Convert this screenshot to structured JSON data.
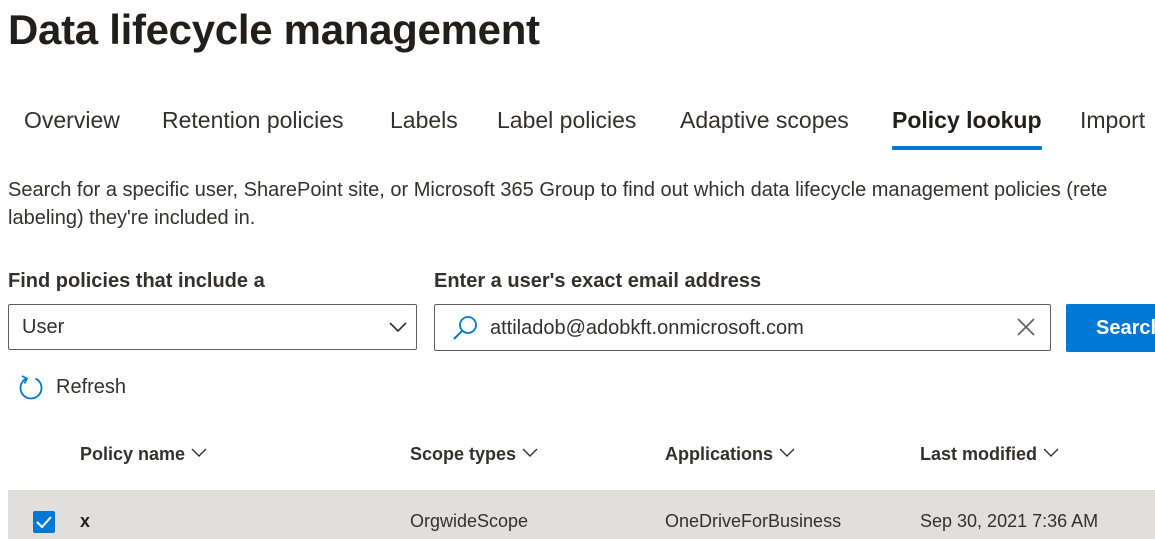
{
  "page": {
    "title": "Data lifecycle management"
  },
  "tabs": [
    {
      "label": "Overview",
      "active": false
    },
    {
      "label": "Retention policies",
      "active": false
    },
    {
      "label": "Labels",
      "active": false
    },
    {
      "label": "Label policies",
      "active": false
    },
    {
      "label": "Adaptive scopes",
      "active": false
    },
    {
      "label": "Policy lookup",
      "active": true
    },
    {
      "label": "Import",
      "active": false
    }
  ],
  "description": {
    "line1": "Search for a specific user, SharePoint site, or Microsoft 365 Group to find out which data lifecycle management policies (rete",
    "line2": "labeling) they're included in."
  },
  "filter": {
    "type_label": "Find policies that include a",
    "type_value": "User",
    "email_label": "Enter a user's exact email address",
    "email_value": "attiladob@adobkft.onmicrosoft.com",
    "search_button": "Search"
  },
  "toolbar": {
    "refresh_label": "Refresh"
  },
  "table": {
    "columns": [
      "Policy name",
      "Scope types",
      "Applications",
      "Last modified"
    ],
    "rows": [
      {
        "selected": true,
        "policy_name": "x",
        "scope_types": "OrgwideScope",
        "applications": "OneDriveForBusiness",
        "last_modified": "Sep 30, 2021 7:36 AM"
      }
    ]
  },
  "colors": {
    "accent": "#0078d4",
    "row_selected_bg": "#e1dfdd",
    "text": "#323130"
  }
}
